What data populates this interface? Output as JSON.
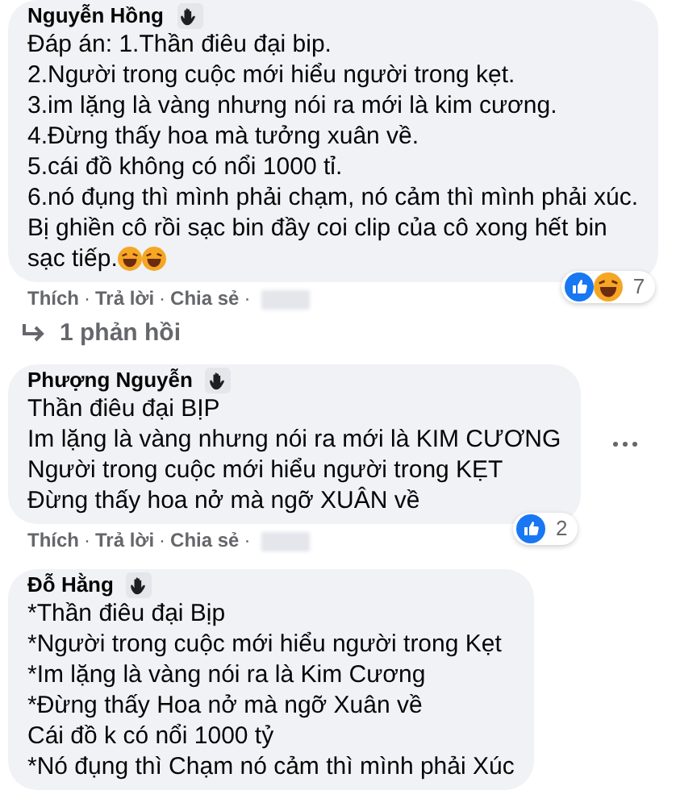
{
  "comments": [
    {
      "author": "Nguyễn Hồng",
      "lines": [
        "Đáp án: 1.Thần điêu đại bip.",
        "2.Người trong cuộc mới hiểu người trong kẹt.",
        "3.im lặng là vàng nhưng nói ra mới là kim cương.",
        "4.Đừng thấy hoa mà tưởng xuân về.",
        "5.cái đồ không có nổi 1000 tỉ.",
        "6.nó đụng thì mình phải chạm, nó cảm thì mình phải xúc.",
        "Bị ghiền cô rồi sạc bin đầy coi clip của cô xong hết bin",
        "sạc tiếp."
      ],
      "emoji": [
        {
          "kind": "laugh"
        },
        {
          "kind": "laugh"
        }
      ],
      "reactions": {
        "icons": [
          {
            "kind": "like"
          },
          {
            "kind": "haha"
          }
        ],
        "count": "7"
      },
      "actions": [
        "Thích",
        "Trả lời",
        "Chia sẻ"
      ],
      "separator": "·",
      "replies": "1 phản hồi"
    },
    {
      "author": "Phượng Nguyễn",
      "lines": [
        "Thần điêu đại BỊP",
        "Im lặng là vàng nhưng nói ra mới là KIM CƯƠNG",
        "Người trong cuộc mới hiểu người trong KẸT",
        "Đừng thấy hoa nở mà ngỡ XUÂN về"
      ],
      "reactions": {
        "icons": [
          {
            "kind": "like"
          }
        ],
        "count": "2"
      },
      "more_menu": true,
      "actions": [
        "Thích",
        "Trả lời",
        "Chia sẻ"
      ],
      "separator": "·"
    },
    {
      "author": "Đỗ Hằng",
      "lines": [
        "*Thần điêu đại Bịp",
        "*Người trong cuộc mới hiểu người trong Kẹt",
        "*Im lặng là vàng nói ra là Kim Cương",
        "*Đừng thấy Hoa nở mà ngỡ Xuân về",
        "Cái đồ k có nổi 1000 tỷ",
        "*Nó đụng thì Chạm nó cảm thì mình phải Xúc"
      ]
    }
  ]
}
